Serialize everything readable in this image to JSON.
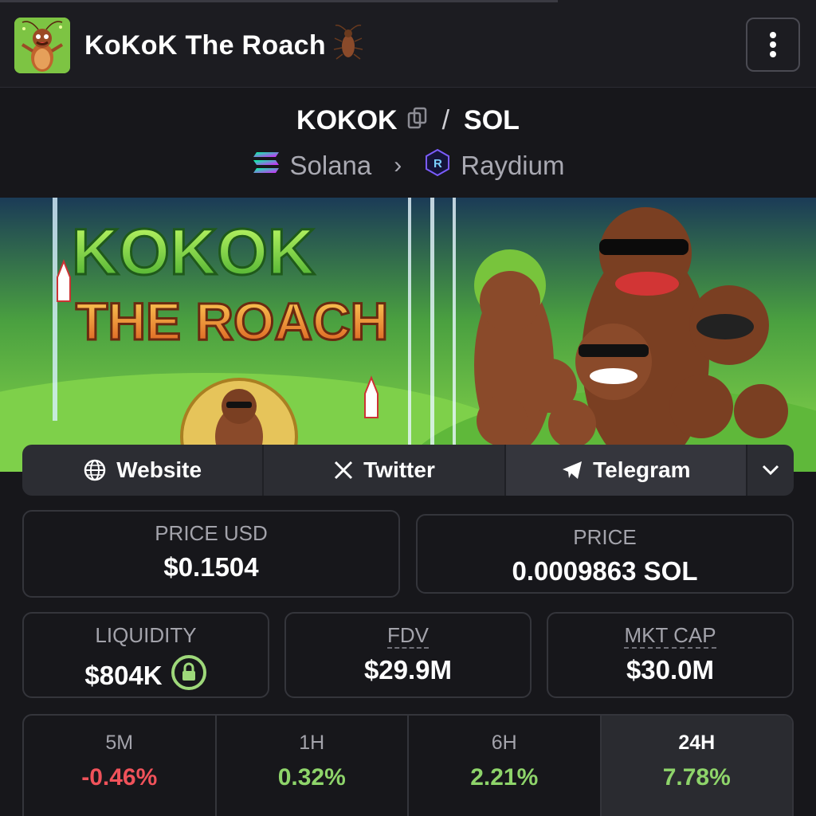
{
  "header": {
    "title": "KoKoK The Roach",
    "logo_icon": "cockroach-logo-icon",
    "menu_icon": "vertical-dots-icon"
  },
  "pair": {
    "base": "KOKOK",
    "separator": "/",
    "quote": "SOL",
    "chain": "Solana",
    "dex": "Raydium"
  },
  "links": [
    {
      "label": "Website",
      "icon": "globe-icon"
    },
    {
      "label": "Twitter",
      "icon": "x-logo-icon"
    },
    {
      "label": "Telegram",
      "icon": "telegram-icon"
    }
  ],
  "stats": {
    "price_usd_label": "PRICE USD",
    "price_usd": "$0.1504",
    "price_label": "PRICE",
    "price_sol": "0.0009863 SOL",
    "liquidity_label": "LIQUIDITY",
    "liquidity": "$804K",
    "fdv_label": "FDV",
    "fdv": "$29.9M",
    "mktcap_label": "MKT CAP",
    "mktcap": "$30.0M"
  },
  "changes": [
    {
      "label": "5M",
      "value": "-0.46%",
      "color": "#f0525a"
    },
    {
      "label": "1H",
      "value": "0.32%",
      "color": "#8ed46a"
    },
    {
      "label": "6H",
      "value": "2.21%",
      "color": "#8ed46a"
    },
    {
      "label": "24H",
      "value": "7.78%",
      "color": "#8ed46a"
    }
  ],
  "banner": {
    "line1": "KOKOK",
    "line2": "THE ROACH"
  }
}
